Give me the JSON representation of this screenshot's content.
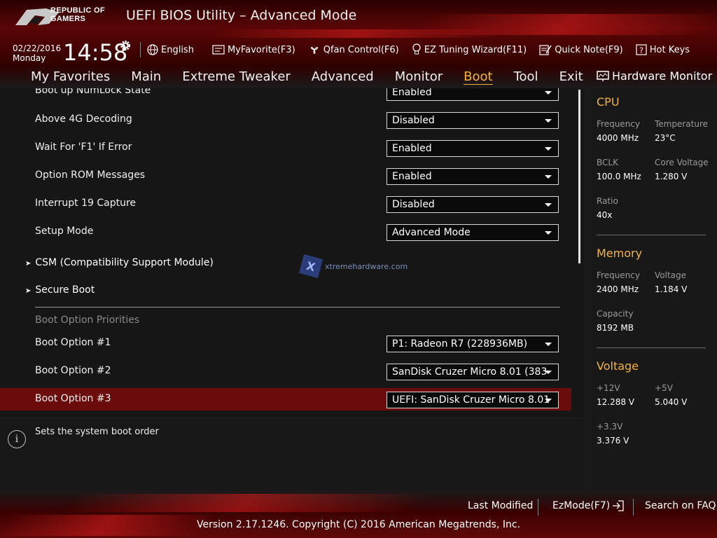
{
  "header": {
    "logo_line1": "REPUBLIC OF",
    "logo_line2": "GAMERS",
    "title": "UEFI BIOS Utility – Advanced Mode",
    "date": "02/22/2016",
    "day": "Monday",
    "time": "14:58"
  },
  "toolbar": {
    "language": "English",
    "my_favorite": "MyFavorite(F3)",
    "qfan": "Qfan Control(F6)",
    "ez_tuning": "EZ Tuning Wizard(F11)",
    "quick_note": "Quick Note(F9)",
    "hot_keys": "Hot Keys"
  },
  "menu": {
    "items": [
      "My Favorites",
      "Main",
      "Extreme Tweaker",
      "Advanced",
      "Monitor",
      "Boot",
      "Tool",
      "Exit"
    ],
    "active": "Boot"
  },
  "settings": [
    {
      "label": "Boot up NumLock State",
      "value": "Enabled"
    },
    {
      "label": "Above 4G Decoding",
      "value": "Disabled"
    },
    {
      "label": "Wait For 'F1' If Error",
      "value": "Enabled"
    },
    {
      "label": "Option ROM Messages",
      "value": "Enabled"
    },
    {
      "label": "Interrupt 19 Capture",
      "value": "Disabled"
    },
    {
      "label": "Setup Mode",
      "value": "Advanced Mode"
    }
  ],
  "submenus": [
    "CSM (Compatibility Support Module)",
    "Secure Boot"
  ],
  "watermark": "xtremehardware.com",
  "boot_priorities": {
    "section_label": "Boot Option Priorities",
    "options": [
      {
        "label": "Boot Option #1",
        "value": "P1: Radeon R7  (228936MB)"
      },
      {
        "label": "Boot Option #2",
        "value": "SanDisk Cruzer Micro 8.01  (383"
      },
      {
        "label": "Boot Option #3",
        "value": "UEFI: SanDisk Cruzer Micro 8.01"
      }
    ]
  },
  "help": {
    "text": "Sets the system boot order",
    "icon": "i"
  },
  "hardware_monitor": {
    "title": "Hardware Monitor",
    "cpu": {
      "title": "CPU",
      "frequency_label": "Frequency",
      "frequency": "4000 MHz",
      "temperature_label": "Temperature",
      "temperature": "23°C",
      "bclk_label": "BCLK",
      "bclk": "100.0 MHz",
      "core_voltage_label": "Core Voltage",
      "core_voltage": "1.280 V",
      "ratio_label": "Ratio",
      "ratio": "40x"
    },
    "memory": {
      "title": "Memory",
      "frequency_label": "Frequency",
      "frequency": "2400 MHz",
      "voltage_label": "Voltage",
      "voltage": "1.184 V",
      "capacity_label": "Capacity",
      "capacity": "8192 MB"
    },
    "voltage": {
      "title": "Voltage",
      "v12_label": "+12V",
      "v12": "12.288 V",
      "v5_label": "+5V",
      "v5": "5.040 V",
      "v33_label": "+3.3V",
      "v33": "3.376 V"
    }
  },
  "footer": {
    "last_modified": "Last Modified",
    "ez_mode": "EzMode(F7)",
    "search_faq": "Search on FAQ",
    "copyright": "Version 2.17.1246. Copyright (C) 2016 American Megatrends, Inc."
  },
  "colors": {
    "accent": "#f5b23d",
    "highlight": "#6b0b0b",
    "brand_red": "#c01818"
  }
}
